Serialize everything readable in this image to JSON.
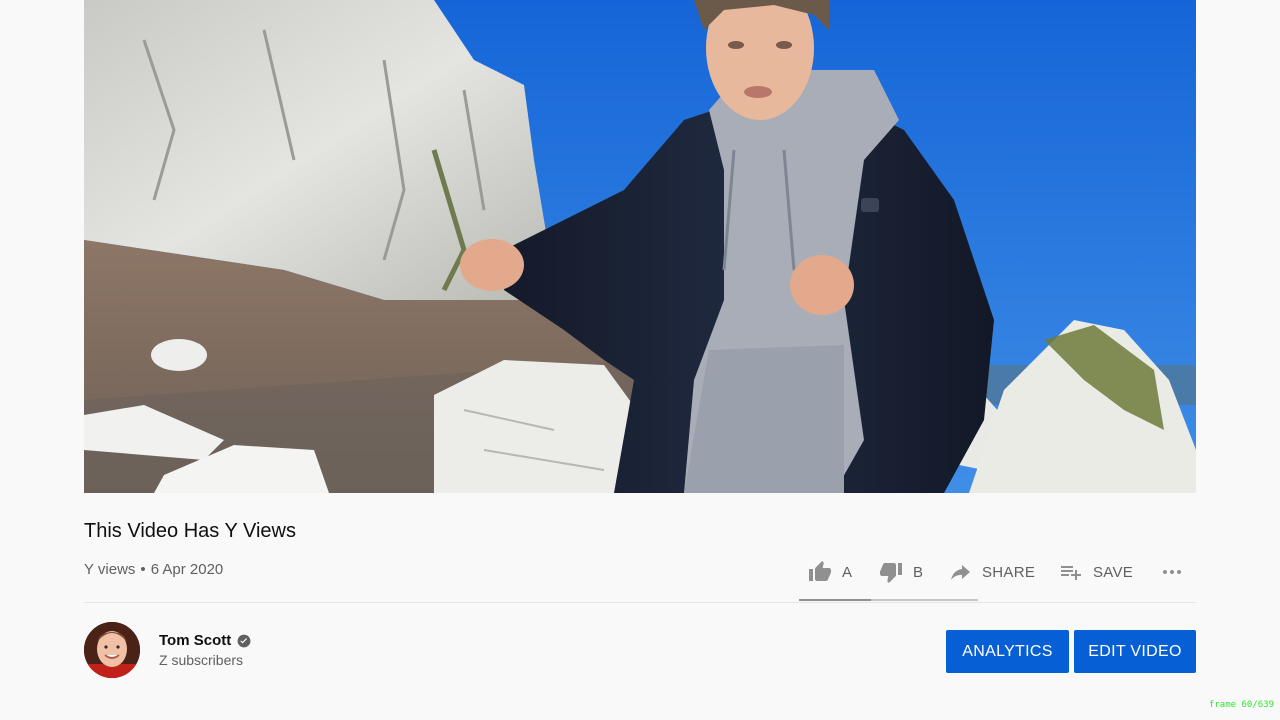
{
  "video": {
    "title": "This Video Has Y Views",
    "views": "Y views",
    "separator": "•",
    "date": "6 Apr 2020"
  },
  "actions": {
    "like_count": "A",
    "dislike_count": "B",
    "share_label": "SHARE",
    "save_label": "SAVE",
    "like_ratio": 0.4
  },
  "channel": {
    "name": "Tom Scott",
    "subscribers": "Z subscribers"
  },
  "buttons": {
    "analytics": "ANALYTICS",
    "edit_video": "EDIT VIDEO"
  },
  "overlay": {
    "frame_counter": "frame 60/639"
  },
  "icons": {
    "like": "thumbs-up-icon",
    "dislike": "thumbs-down-icon",
    "share": "share-arrow-icon",
    "save": "playlist-add-icon",
    "more": "more-horizontal-icon",
    "verified": "verified-check-icon"
  },
  "colors": {
    "accent_button": "#065fd4",
    "frame_counter": "#2ee62e"
  }
}
